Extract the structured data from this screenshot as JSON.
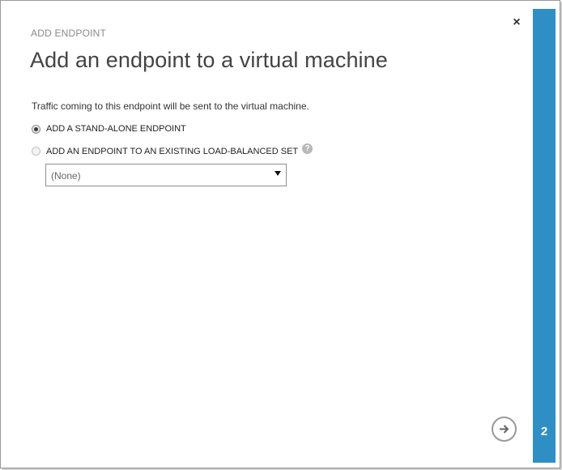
{
  "dialog": {
    "subtitle": "ADD ENDPOINT",
    "title": "Add an endpoint to a virtual machine",
    "description": "Traffic coming to this endpoint will be sent to the virtual machine.",
    "close_icon": "×",
    "step_number": "2"
  },
  "options": [
    {
      "label": "ADD A STAND-ALONE ENDPOINT",
      "checked": true
    },
    {
      "label": "ADD AN ENDPOINT TO AN EXISTING LOAD-BALANCED SET",
      "checked": false,
      "help_icon": "?"
    }
  ],
  "load_balanced_select": {
    "value": "(None)"
  },
  "icons": {
    "close": "close-icon",
    "help": "help-icon",
    "next": "arrow-right-icon"
  },
  "colors": {
    "accent_bar": "#2f8fc4",
    "title_text": "#444444",
    "subtitle_text": "#8a8a8a"
  }
}
